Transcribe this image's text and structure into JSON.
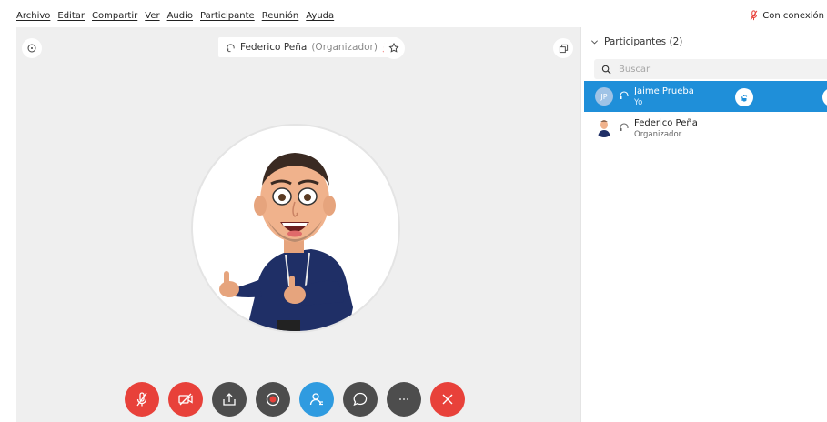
{
  "menu": [
    "Archivo",
    "Editar",
    "Compartir",
    "Ver",
    "Audio",
    "Participante",
    "Reunión",
    "Ayuda"
  ],
  "status": {
    "label": "Con conexión",
    "icon": "mic-muted-icon",
    "color": "#e8413a"
  },
  "presenter": {
    "name": "Federico Peña",
    "role": "(Organizador)"
  },
  "participants": {
    "header": "Participantes (2)",
    "search_placeholder": "Buscar",
    "list": [
      {
        "initials": "JP",
        "name": "Jaime Prueba",
        "role": "Yo",
        "selected": true
      },
      {
        "name": "Federico Peña",
        "role": "Organizador",
        "selected": false
      }
    ]
  },
  "controls": [
    {
      "name": "mute-button",
      "icon": "mic-muted-icon",
      "color": "#e8413a"
    },
    {
      "name": "video-button",
      "icon": "video-off-icon",
      "color": "#e8413a"
    },
    {
      "name": "share-button",
      "icon": "share-icon",
      "color": "#4d4d4d"
    },
    {
      "name": "record-button",
      "icon": "record-icon",
      "color": "#4d4d4d"
    },
    {
      "name": "participants-button",
      "icon": "participants-icon",
      "color": "#2f9be0"
    },
    {
      "name": "chat-button",
      "icon": "chat-icon",
      "color": "#4d4d4d"
    },
    {
      "name": "more-button",
      "icon": "more-icon",
      "color": "#4d4d4d"
    },
    {
      "name": "end-call-button",
      "icon": "close-icon",
      "color": "#e8413a"
    }
  ],
  "colors": {
    "accent": "#1f8fd9",
    "stage": "#efefef"
  }
}
